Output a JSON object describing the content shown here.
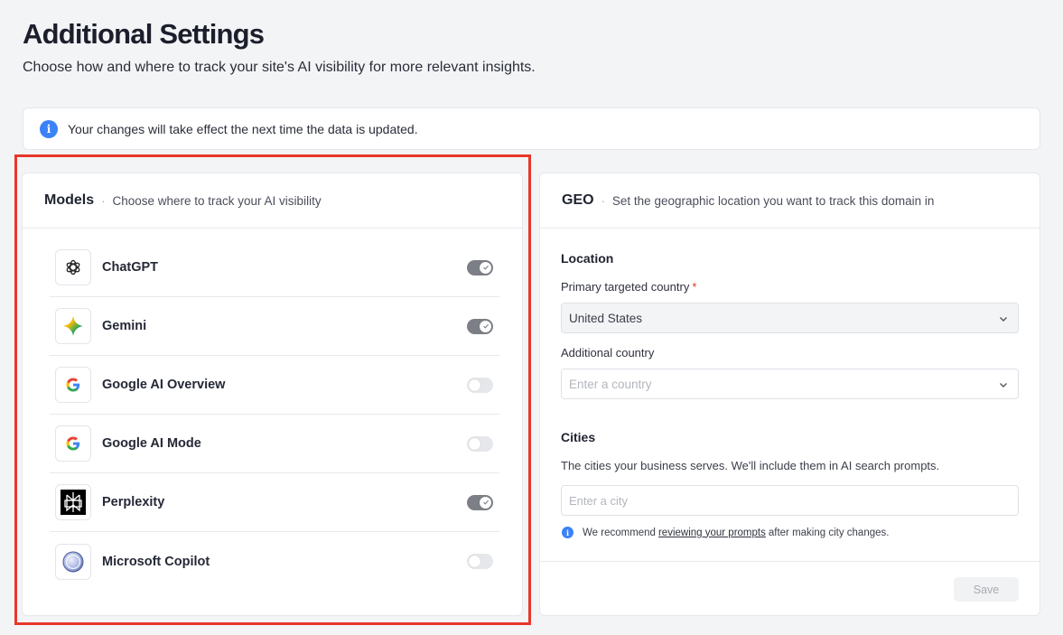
{
  "page": {
    "title": "Additional Settings",
    "subtitle": "Choose how and where to track your site's AI visibility for more relevant insights."
  },
  "banner": {
    "icon": "info-icon",
    "text": "Your changes will take effect the next time the data is updated."
  },
  "models": {
    "title": "Models",
    "separator": "·",
    "description": "Choose where to track your AI visibility",
    "items": [
      {
        "name": "ChatGPT",
        "icon": "chatgpt-icon",
        "enabled": true
      },
      {
        "name": "Gemini",
        "icon": "gemini-icon",
        "enabled": true
      },
      {
        "name": "Google AI Overview",
        "icon": "google-icon",
        "enabled": false
      },
      {
        "name": "Google AI Mode",
        "icon": "google-icon",
        "enabled": false
      },
      {
        "name": "Perplexity",
        "icon": "perplexity-icon",
        "enabled": true
      },
      {
        "name": "Microsoft Copilot",
        "icon": "copilot-icon",
        "enabled": false
      }
    ]
  },
  "geo": {
    "title": "GEO",
    "separator": "·",
    "description": "Set the geographic location you want to track this domain in",
    "location": {
      "section_title": "Location",
      "primary_label": "Primary targeted country",
      "required_mark": "*",
      "primary_value": "United States",
      "additional_label": "Additional country",
      "additional_placeholder": "Enter a country"
    },
    "cities": {
      "section_title": "Cities",
      "description": "The cities your business serves. We'll include them in AI search prompts.",
      "placeholder": "Enter a city",
      "recommend_prefix": "We recommend",
      "recommend_link": "reviewing your prompts",
      "recommend_suffix": "after making city changes."
    },
    "save_label": "Save"
  },
  "colors": {
    "accent": "#3b82f6",
    "highlight": "#e8372c",
    "toggle_on": "#7d7f86",
    "toggle_off": "#e6e7ea"
  }
}
